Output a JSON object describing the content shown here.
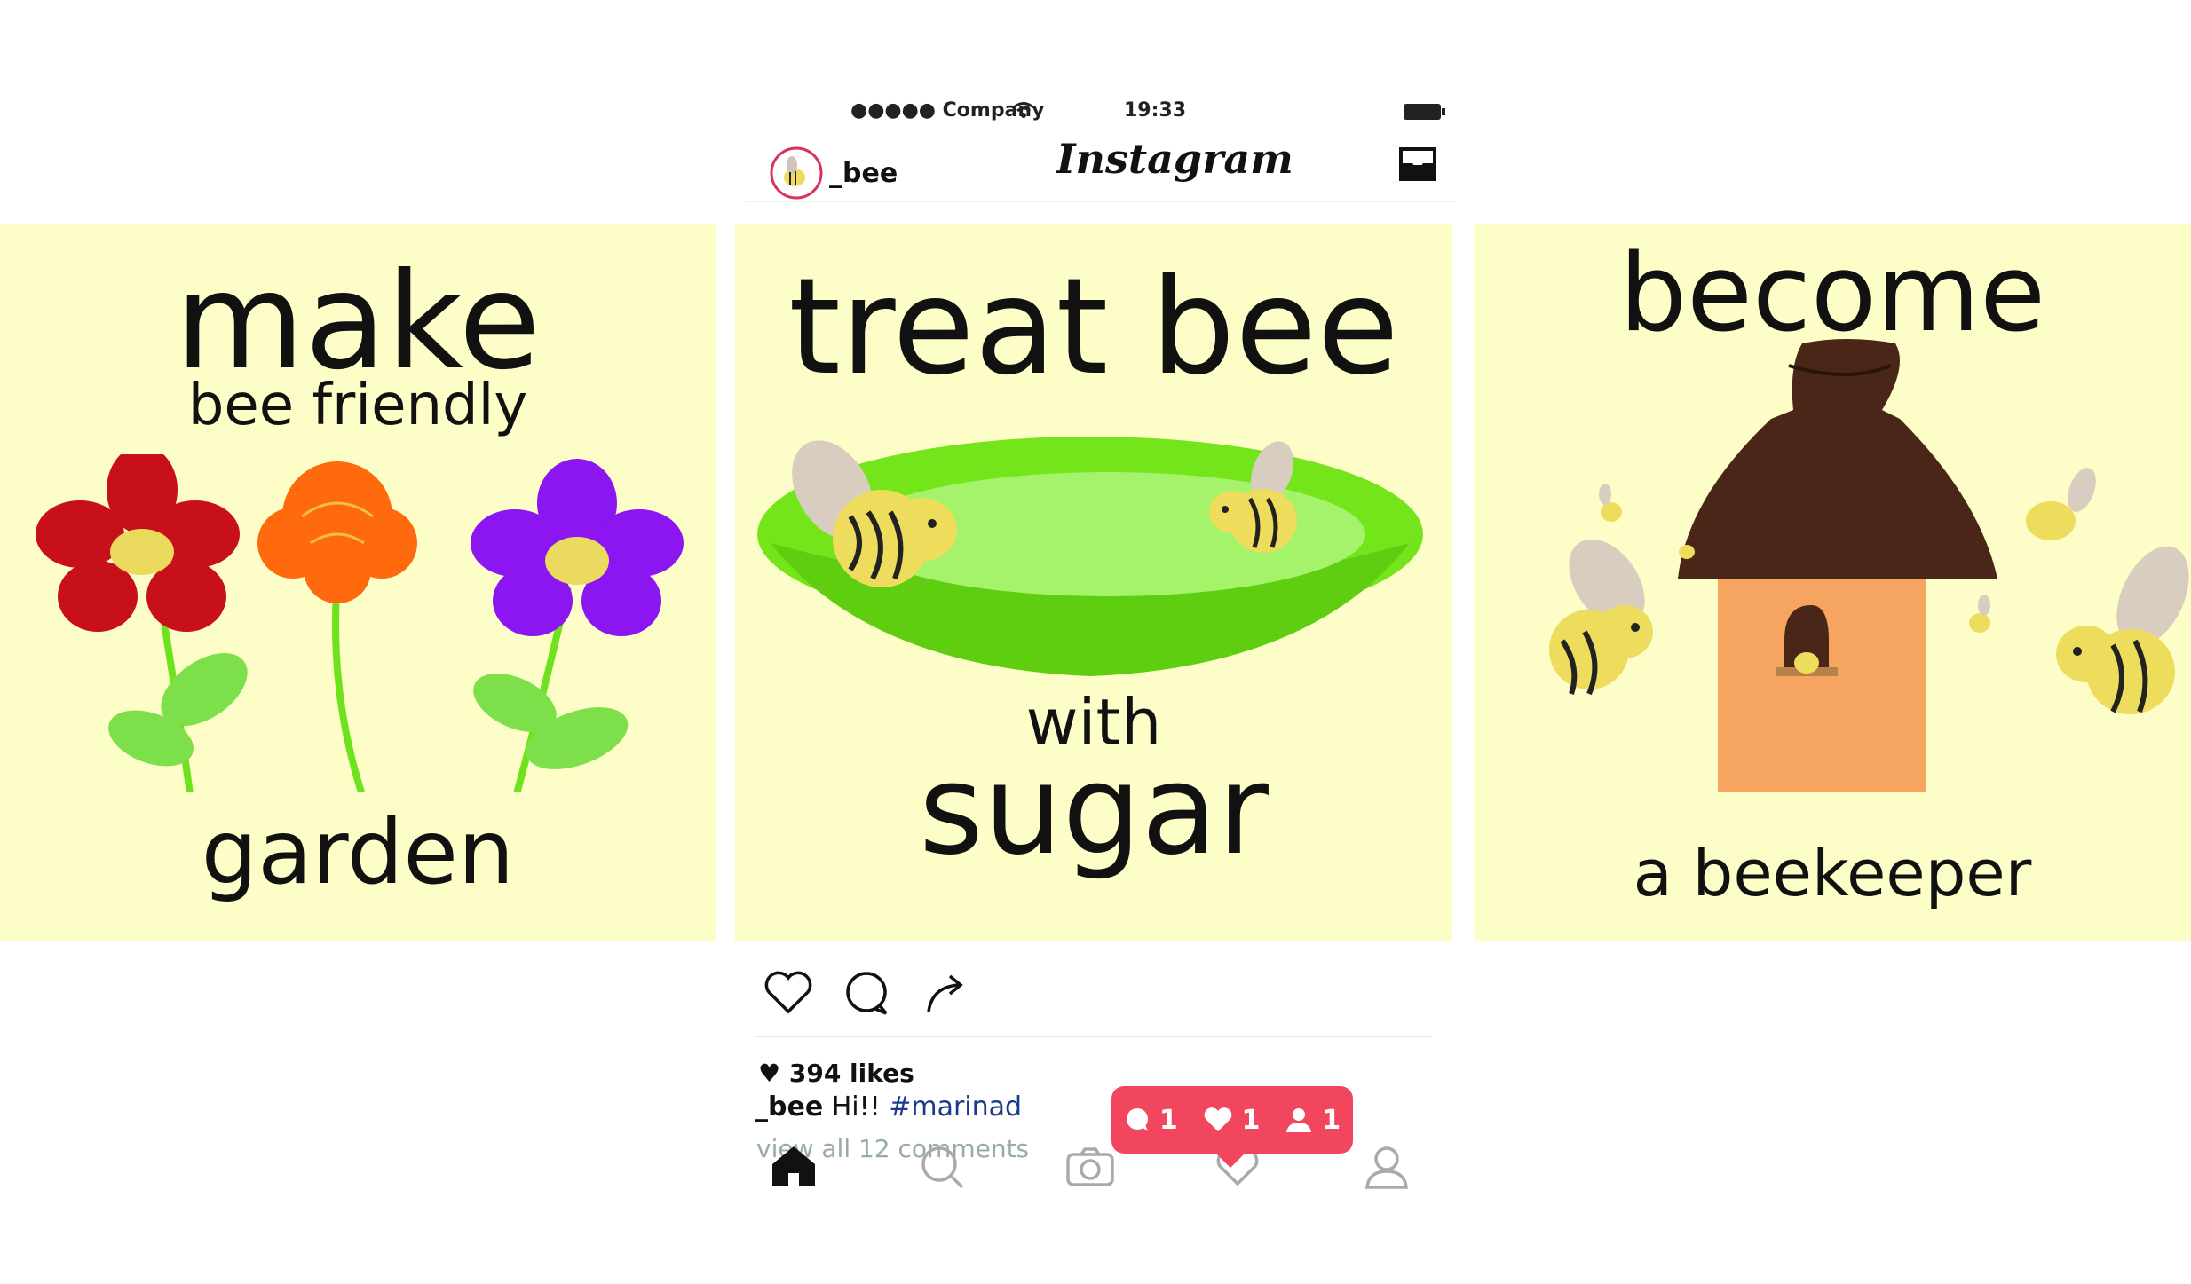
{
  "status_bar": {
    "carrier": "●●●●● Company",
    "time": "19:33"
  },
  "header": {
    "username": "_bee",
    "app_title": "Instagram"
  },
  "panels": {
    "left": {
      "line1": "make",
      "line2": "bee friendly",
      "line3": "garden"
    },
    "center": {
      "line1": "treat bee",
      "line2": "with",
      "line3": "sugar"
    },
    "right": {
      "line1": "become",
      "line2": "a beekeeper"
    }
  },
  "post": {
    "likes": "394 likes",
    "caption_user": "_bee",
    "caption_text": " Hi!! ",
    "caption_tag": "#marinad",
    "comments_link": "view all 12 comments"
  },
  "notification": {
    "comments": "1",
    "likes": "1",
    "follows": "1"
  },
  "colors": {
    "panel_bg": "#fdfdc8",
    "notif_bg": "#f2465e",
    "hashtag": "#1b3a8a"
  },
  "icons": [
    "wifi-icon",
    "battery-icon",
    "inbox-icon",
    "heart-icon",
    "comment-icon",
    "share-icon",
    "home-icon",
    "search-icon",
    "camera-icon",
    "activity-icon",
    "profile-icon"
  ]
}
